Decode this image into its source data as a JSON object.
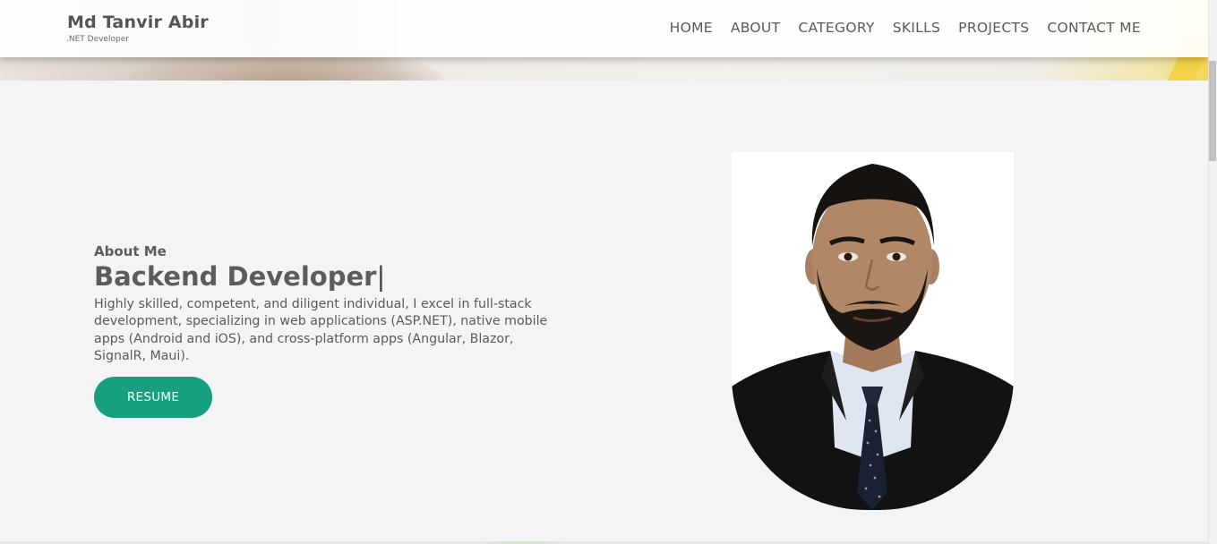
{
  "brand": {
    "name": "Md Tanvir Abir",
    "subtitle": ".NET Developer"
  },
  "nav": {
    "items": [
      {
        "label": "HOME"
      },
      {
        "label": "ABOUT"
      },
      {
        "label": "CATEGORY"
      },
      {
        "label": "SKILLS"
      },
      {
        "label": "PROJECTS"
      },
      {
        "label": "CONTACT ME"
      }
    ]
  },
  "about": {
    "label": "About Me",
    "headline": "Backend Developer",
    "cursor": "|",
    "bio": "Highly skilled, competent, and diligent individual, I excel in full-stack development, specializing in web applications (ASP.NET), native mobile apps (Android and iOS), and cross-platform apps (Angular, Blazor, SignalR, Maui).",
    "resume_label": "RESUME"
  },
  "colors": {
    "accent": "#17a080",
    "text": "#5c5c5c",
    "background": "#f4f4f6"
  }
}
